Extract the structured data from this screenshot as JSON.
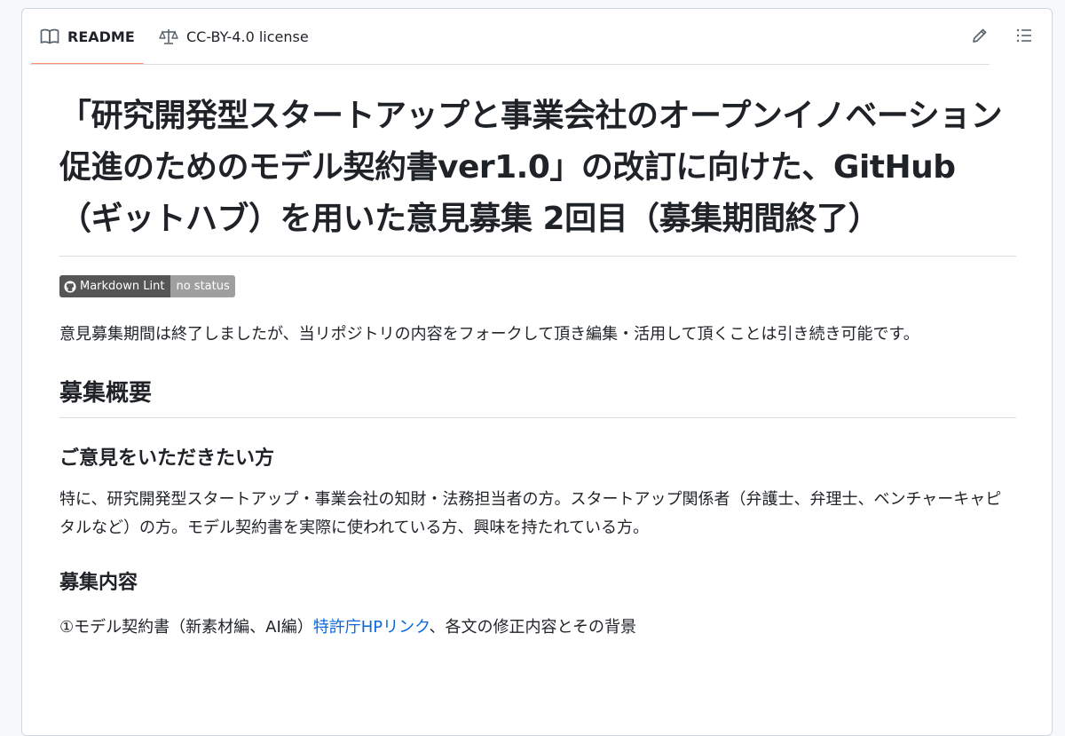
{
  "tabs": {
    "readme": "README",
    "license": "CC-BY-4.0 license"
  },
  "readme": {
    "title": "「研究開発型スタートアップと事業会社のオープンイノベーション促進のためのモデル契約書ver1.0」の改訂に向けた、GitHub（ギットハブ）を用いた意見募集 2回目（募集期間終了）",
    "badge": {
      "label": "Markdown Lint",
      "status": "no status"
    },
    "intro": "意見募集期間は終了しましたが、当リポジトリの内容をフォークして頂き編集・活用して頂くことは引き続き可能です。",
    "section_overview": "募集概要",
    "sub_audience": "ご意見をいただきたい方",
    "audience_text": "特に、研究開発型スタートアップ・事業会社の知財・法務担当者の方。スタートアップ関係者（弁護士、弁理士、ベンチャーキャピタルなど）の方。モデル契約書を実際に使われている方、興味を持たれている方。",
    "sub_content": "募集内容",
    "content_item": {
      "prefix": "①モデル契約書（新素材編、AI編）",
      "link": "特許庁HPリンク",
      "suffix": "、各文の修正内容とその背景"
    }
  },
  "colors": {
    "accent_underline": "#fd8c73",
    "link": "#0969da",
    "badge_left": "#555555",
    "badge_right": "#9f9f9f"
  },
  "icons": {
    "readme_tab": "book-icon",
    "license_tab": "law-scale-icon",
    "edit": "pencil-icon",
    "outline": "list-unordered-icon",
    "badge": "github-mark-icon"
  }
}
